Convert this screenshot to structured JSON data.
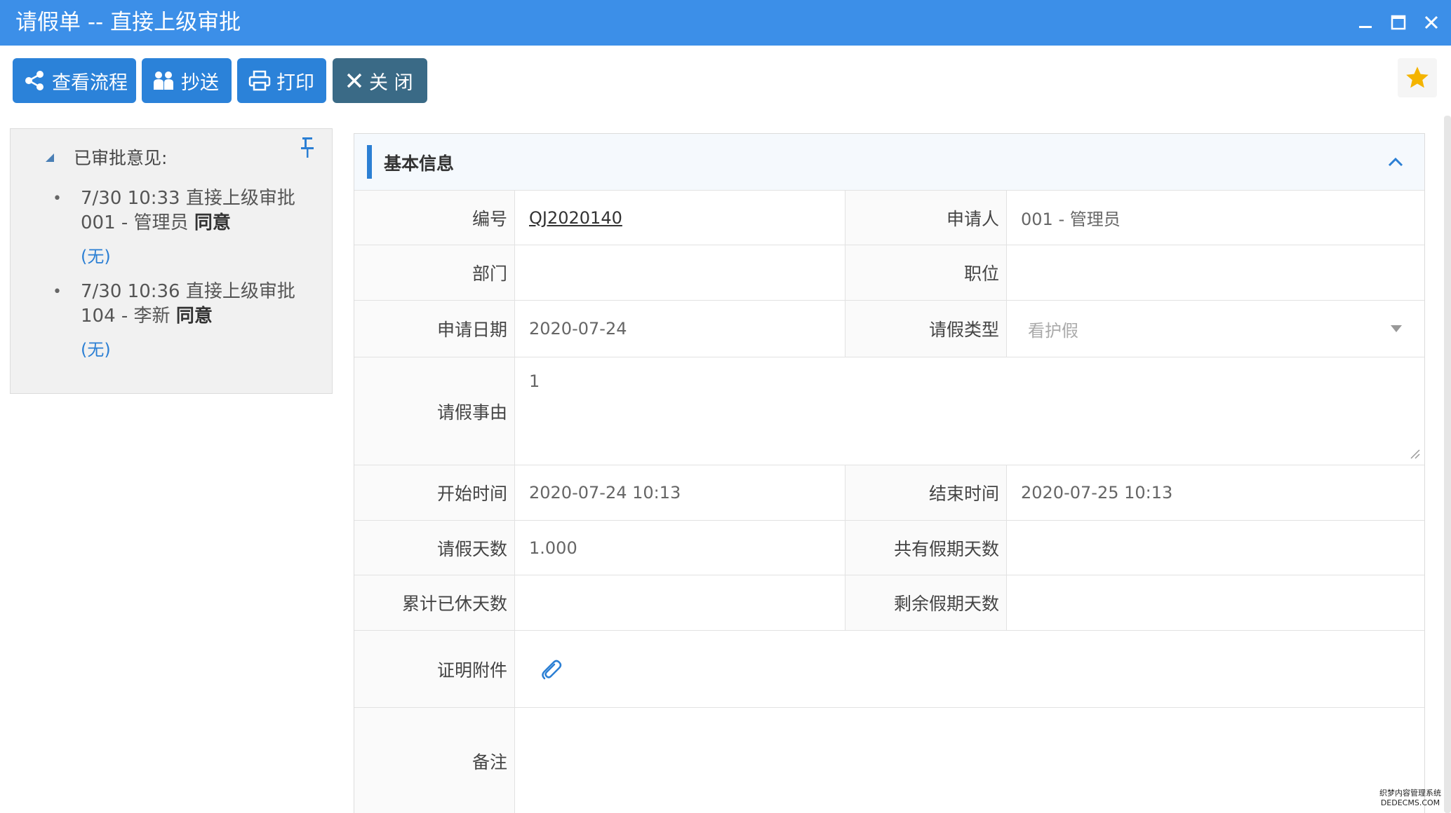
{
  "window": {
    "title": "请假单 -- 直接上级审批",
    "minimize_icon": "minimize-icon",
    "maximize_icon": "maximize-icon",
    "close_icon": "close-icon",
    "title_bar_color": "#3c8fe8"
  },
  "toolbar": {
    "view_flow_label": "查看流程",
    "cc_label": "抄送",
    "print_label": "打印",
    "close_label": "关 闭",
    "favorite_icon": "star-icon",
    "primary_color": "#2b82d9",
    "close_color": "#3a6a86",
    "star_color": "#f4b400"
  },
  "approval_panel": {
    "heading": "已审批意见:",
    "opinions": [
      {
        "time": "7/30 10:33",
        "step": "直接上级审批",
        "user": "001 - 管理员",
        "result": "同意",
        "comment": "(无)"
      },
      {
        "time": "7/30 10:36",
        "step": "直接上级审批",
        "user": "104 - 李新",
        "result": "同意",
        "comment": "(无)"
      }
    ]
  },
  "form": {
    "section_title": "基本信息",
    "accent_color": "#2b7fd4",
    "fields": {
      "number": {
        "label": "编号",
        "value": "QJ2020140"
      },
      "applicant": {
        "label": "申请人",
        "value": "001 - 管理员"
      },
      "department": {
        "label": "部门",
        "value": ""
      },
      "position": {
        "label": "职位",
        "value": ""
      },
      "apply_date": {
        "label": "申请日期",
        "value": "2020-07-24"
      },
      "leave_type": {
        "label": "请假类型",
        "value": "看护假"
      },
      "reason": {
        "label": "请假事由",
        "value": "1"
      },
      "start_time": {
        "label": "开始时间",
        "value": "2020-07-24 10:13"
      },
      "end_time": {
        "label": "结束时间",
        "value": "2020-07-25 10:13"
      },
      "leave_days": {
        "label": "请假天数",
        "value": "1.000"
      },
      "total_holiday_days": {
        "label": "共有假期天数",
        "value": ""
      },
      "used_days": {
        "label": "累计已休天数",
        "value": ""
      },
      "remaining_days": {
        "label": "剩余假期天数",
        "value": ""
      },
      "attachment": {
        "label": "证明附件",
        "icon": "paperclip-icon"
      },
      "remarks": {
        "label": "备注",
        "value": ""
      }
    }
  },
  "watermark": {
    "line1": "织梦内容管理系统",
    "line2": "DEDECMS.COM"
  }
}
